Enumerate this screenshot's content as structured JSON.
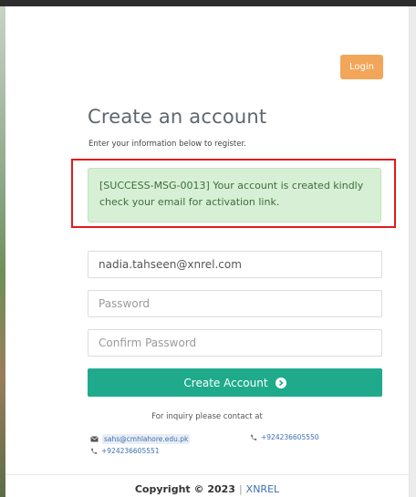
{
  "header": {
    "login_label": "Login"
  },
  "form": {
    "title": "Create an account",
    "subtitle": "Enter your information below to register.",
    "alert_message": "[SUCCESS-MSG-0013] Your account is created kindly check your email for activation link.",
    "email_value": "nadia.tahseen@xnrel.com",
    "password_placeholder": "Password",
    "confirm_placeholder": "Confirm Password",
    "submit_label": "Create Account"
  },
  "contact": {
    "heading": "For inquiry please contact at",
    "email": "sahs@cmhlahore.edu.pk",
    "phone_1": "+924236605550",
    "phone_2": "+924236605551"
  },
  "footer": {
    "copyright": "Copyright © 2023",
    "separator": "|",
    "brand": "XNREL"
  },
  "colors": {
    "accent_green": "#1fab8b",
    "login_orange": "#f2a659",
    "alert_bg": "#d7f0d5",
    "highlight_red": "#dd1c1c"
  }
}
